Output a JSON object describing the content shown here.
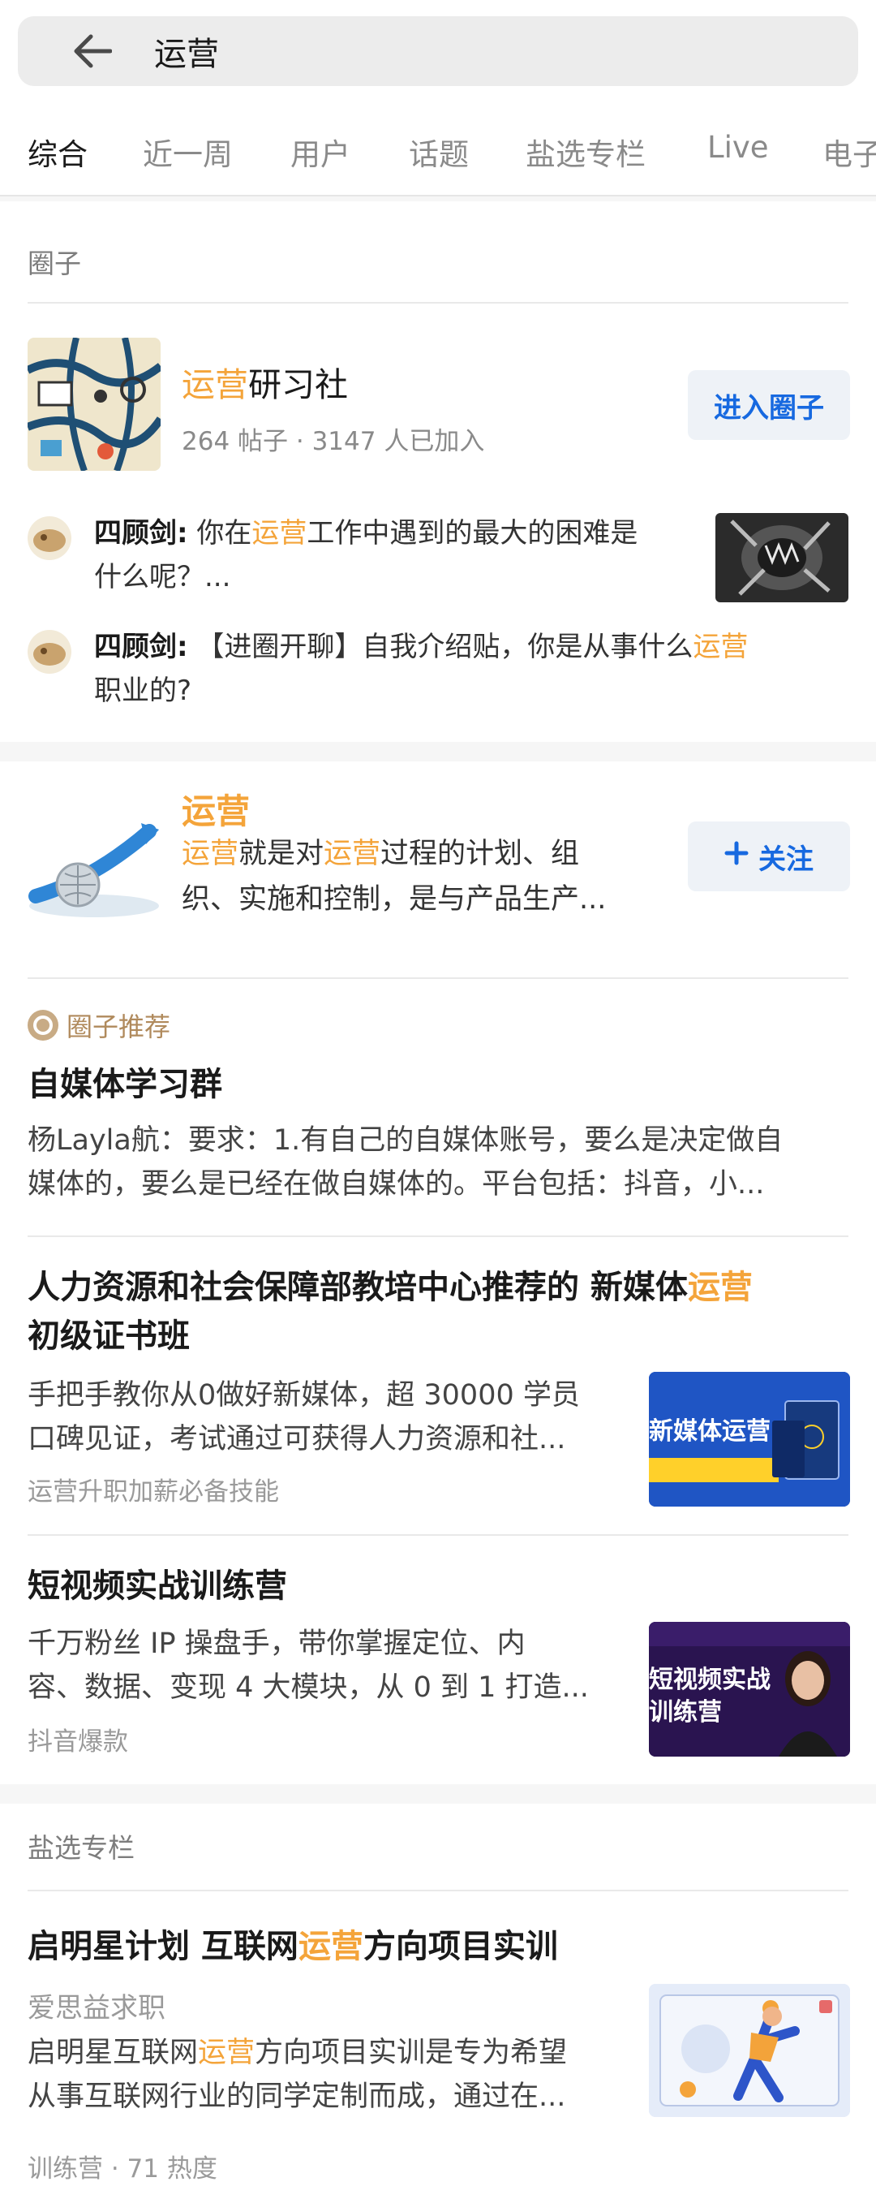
{
  "search": {
    "query": "运营"
  },
  "tabs": [
    "综合",
    "近一周",
    "用户",
    "话题",
    "盐选专栏",
    "Live",
    "电子"
  ],
  "circles_section": {
    "title": "圈子",
    "circle": {
      "name_highlight": "运营",
      "name_rest": "研习社",
      "meta": "264 帖子 · 3147 人已加入",
      "enter_button": "进入圈子"
    },
    "posts": [
      {
        "author": "四顾剑:",
        "line1_pre": " 你在",
        "line1_hl": "运营",
        "line1_post": "工作中遇到的最大的困难是",
        "line2": "什么呢？..."
      },
      {
        "author": "四顾剑:",
        "line1_pre": " 【进圈开聊】自我介绍贴，你是从事什么",
        "line1_hl": "运营",
        "line2": "职业的?"
      }
    ]
  },
  "topic_section": {
    "topic": {
      "title": "运营",
      "desc_hl1": "运营",
      "desc_t1": "就是对",
      "desc_hl2": "运营",
      "desc_t2": "过程的计划、组",
      "desc_line2": "织、实施和控制，是与产品生产...",
      "follow_button": "关注"
    },
    "recommend_label": "圈子推荐",
    "cards": [
      {
        "title": "自媒体学习群",
        "body1": "杨Layla航：要求：1.有自己的自媒体账号，要么是决定做自",
        "body2": "媒体的，要么是已经在做自媒体的。平台包括：抖音，小..."
      },
      {
        "title1_pre": "人力资源和社会保障部教培中心推荐的 新媒体",
        "title1_hl": "运营",
        "title2": "初级证书班",
        "body1": "手把手教你从0做好新媒体，超 30000 学员",
        "body2": "口碑见证，考试通过可获得人力资源和社...",
        "tag": "运营升职加薪必备技能",
        "img_text": "新媒体运营"
      },
      {
        "title": "短视频实战训练营",
        "body1": "千万粉丝 IP 操盘手，带你掌握定位、内",
        "body2": "容、数据、变现 4 大模块，从 0 到 1 打造...",
        "tag": "抖音爆款",
        "img_text1": "短视频实战",
        "img_text2": "训练营"
      }
    ]
  },
  "column_section": {
    "title": "盐选专栏",
    "item": {
      "title_pre": "启明星计划 互联网",
      "title_hl": "运营",
      "title_post": "方向项目实训",
      "author": "爱思益求职",
      "body1_pre": "启明星互联网",
      "body1_hl": "运营",
      "body1_post": "方向项目实训是专为希望",
      "body2": "从事互联网行业的同学定制而成，通过在...",
      "meta": "训练营 · 71 热度"
    }
  },
  "colors": {
    "highlight": "#f4a43a",
    "link_blue": "#1769e0",
    "page_bg": "#f6f6f6"
  }
}
